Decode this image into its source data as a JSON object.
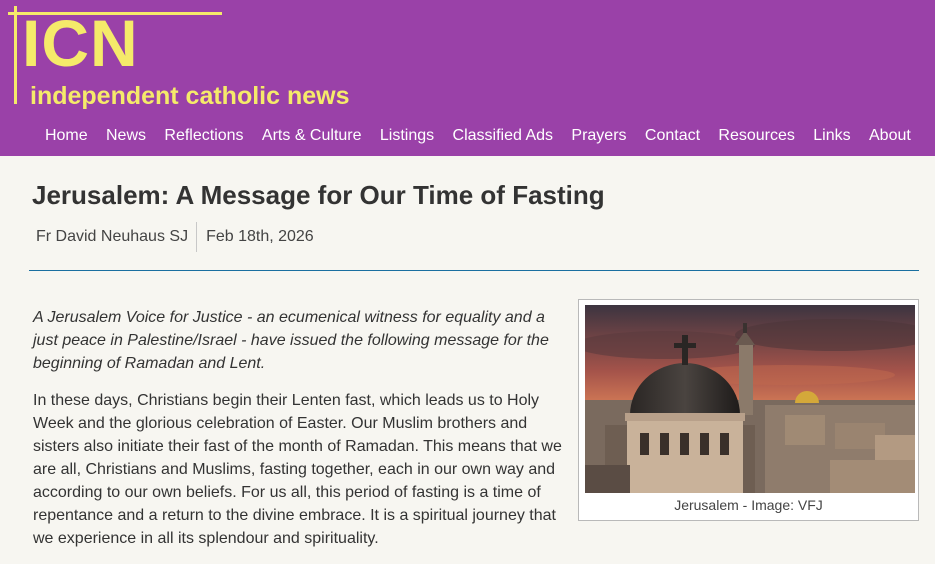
{
  "header": {
    "logo_text": "ICN",
    "logo_tagline": "independent catholic news",
    "brand_color": "#9a41a8",
    "logo_color": "#f5ea6a"
  },
  "nav": {
    "items": [
      "Home",
      "News",
      "Reflections",
      "Arts & Culture",
      "Listings",
      "Classified Ads",
      "Prayers",
      "Contact",
      "Resources",
      "Links",
      "About"
    ]
  },
  "article": {
    "title": "Jerusalem: A Message for Our Time of Fasting",
    "author": "Fr David Neuhaus SJ",
    "date": "Feb 18th, 2026",
    "intro": "A Jerusalem Voice for Justice - an ecumenical witness for equality and a just peace in Palestine/Israel - have issued the following message for the beginning of Ramadan and Lent.",
    "paragraph1": "In these days, Christians begin their Lenten fast, which leads us to Holy Week and the glorious celebration of Easter. Our Muslim brothers and sisters also initiate their fast of the month of Ramadan. This means that we are all, Christians and Muslims, fasting together, each in our own way and according to our own beliefs. For us all, this period of fasting is a time of repentance and a return to the divine embrace. It is a spiritual journey that we experience in all its splendour and spirituality."
  },
  "figure": {
    "caption": "Jerusalem - Image: VFJ"
  }
}
